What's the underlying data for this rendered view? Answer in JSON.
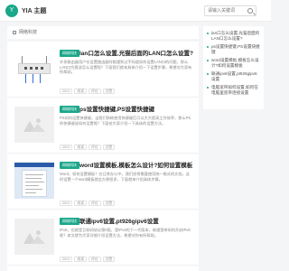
{
  "header": {
    "logo_text": "Y",
    "site_name": "YIA 主题",
    "search_placeholder": "请输入关键词"
  },
  "breadcrumb": {
    "current": "网络科技"
  },
  "posts": [
    {
      "tag": "网络科技",
      "title": "lan口怎么设置,光猫后面的LAN口怎么设置?",
      "excerpt": "许多路由器用户在设置路由器时都遇到过不知道如何设置LAN口的问题，那么LAN口究竟该怎么设置呢？下面我们就来具体介绍一下设置步骤，希望对大家有所帮助。",
      "meta": [
        "2021",
        "阅读",
        "评论",
        "点赞"
      ],
      "thumb": "router"
    },
    {
      "tag": "网络科技",
      "title": "ps设置快捷键,PS设置快捷键",
      "excerpt": "PS如何设置快捷键，当我们熟练使用快捷键后可以大大提高工作效率，那么PS的快捷键该如何设置呢？下面给大家介绍一下具体的设置方法。",
      "meta": [
        "2021",
        "阅读",
        "评论",
        "点赞"
      ],
      "thumb": "generic"
    },
    {
      "tag": "网络科技",
      "title": "word设置模板,模板怎么设计?如何设置模板",
      "excerpt": "Word，如何设置模板？在日常办公中，我们经常需要使用统一格式的文档，这时设置一个word模板就会方便很多，下面就来介绍具体步骤。",
      "meta": [
        "2021",
        "阅读",
        "评论",
        "点赞"
      ],
      "thumb": "doc"
    },
    {
      "tag": "网络科技",
      "title": "联通ipv6设置,pt926gipv6设置",
      "excerpt": "IPv6，也就是互联网协议第6版，是IPv4的下一代版本，联通宽带如何开启IPv6呢？本文就为大家详细介绍设置方法，希望对你有所帮助。",
      "meta": [
        "2021",
        "阅读",
        "评论",
        "点赞"
      ],
      "thumb": "generic"
    }
  ],
  "sidebar": {
    "links": [
      "lan口怎么设置,光猫后面的LAN口怎么设置?",
      "ps设置快捷键,PS设置快捷键",
      "word设置模板,模板怎么设计?如何设置模板",
      "联通ipv6设置,pt926gipv6设置",
      "电脑宽带如何设置,如何在电脑里宽带连接设置"
    ]
  }
}
